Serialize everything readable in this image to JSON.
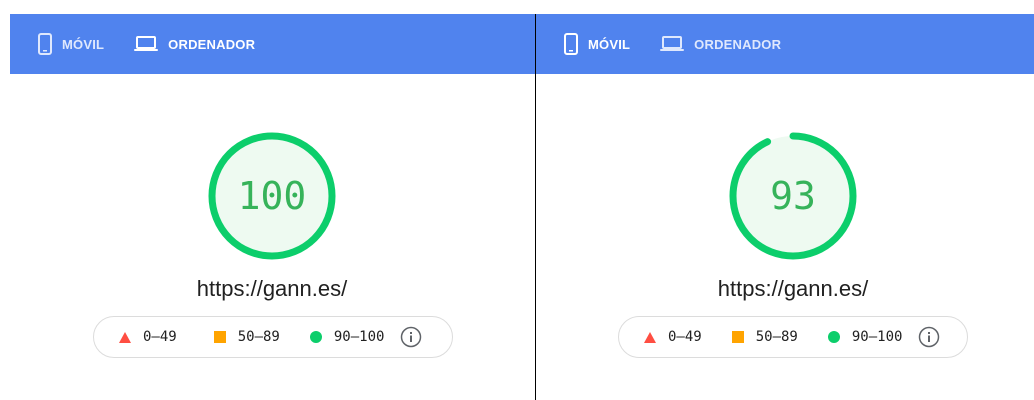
{
  "colors": {
    "header_blue": "#5083ee",
    "pass_green": "#0cce6b",
    "pass_text": "#36b35a",
    "gauge_fill": "#eefaf1",
    "average_orange": "#ffa400",
    "fail_red": "#ff4e42"
  },
  "panels": [
    {
      "tabs": {
        "mobile": {
          "label": "MÓVIL",
          "icon": "phone-icon",
          "active": false
        },
        "desktop": {
          "label": "ORDENADOR",
          "icon": "laptop-icon",
          "active": true
        }
      },
      "score": {
        "value": "100",
        "fraction": 1.0
      },
      "url": "https://gann.es/",
      "legend": {
        "fail": "0–49",
        "average": "50–89",
        "pass": "90–100",
        "info_icon": "info-icon"
      }
    },
    {
      "tabs": {
        "mobile": {
          "label": "MÓVIL",
          "icon": "phone-icon",
          "active": true
        },
        "desktop": {
          "label": "ORDENADOR",
          "icon": "laptop-icon",
          "active": false
        }
      },
      "score": {
        "value": "93",
        "fraction": 0.93
      },
      "url": "https://gann.es/",
      "legend": {
        "fail": "0–49",
        "average": "50–89",
        "pass": "90–100",
        "info_icon": "info-icon"
      }
    }
  ]
}
